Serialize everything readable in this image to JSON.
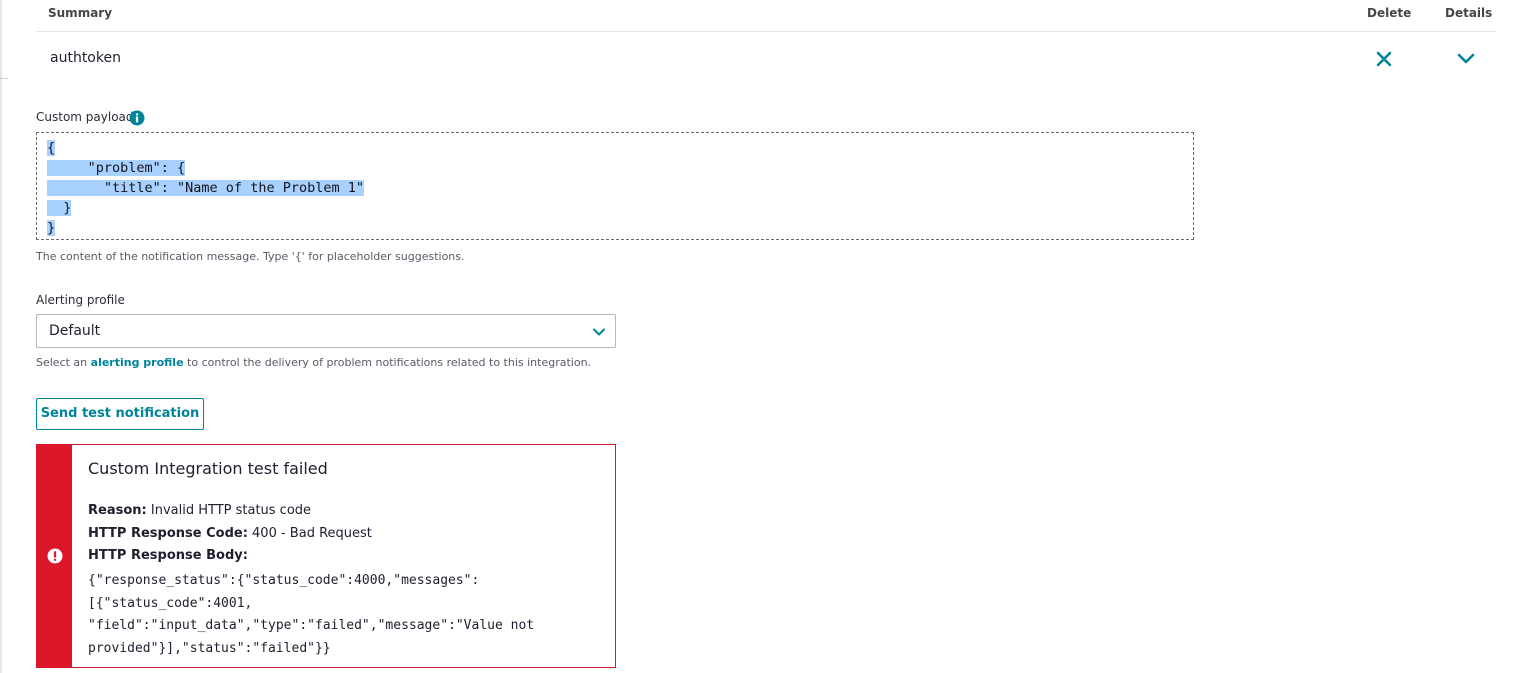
{
  "table": {
    "headers": {
      "summary": "Summary",
      "delete": "Delete",
      "details": "Details"
    },
    "row": {
      "name": "authtoken"
    }
  },
  "payload": {
    "label": "Custom payload",
    "lines": [
      "{",
      "     \"problem\": {",
      "       \"title\": \"Name of the Problem 1\"",
      "  }",
      "}"
    ],
    "help": "The content of the notification message. Type '{' for placeholder suggestions."
  },
  "alerting": {
    "label": "Alerting profile",
    "selected": "Default",
    "help_before": "Select an ",
    "help_link": "alerting profile",
    "help_after": " to control the delivery of problem notifications related to this integration."
  },
  "send_button": {
    "label": "Send test notification"
  },
  "error": {
    "title": "Custom Integration test failed",
    "reason_label": "Reason:",
    "reason_value": " Invalid HTTP status code",
    "code_label": "HTTP Response Code:",
    "code_value": " 400 - Bad Request",
    "body_label": "HTTP Response Body:",
    "body_lines": [
      "{\"response_status\":{\"status_code\":4000,\"messages\":",
      "[{\"status_code\":4001,",
      "\"field\":\"input_data\",\"type\":\"failed\",\"message\":\"Value not",
      "provided\"}],\"status\":\"failed\"}}"
    ]
  },
  "colors": {
    "accent": "#00849b",
    "error": "#dc172a",
    "selection": "#a8d1ff"
  },
  "icons": {
    "delete": "close-icon",
    "details": "chevron-down-icon",
    "info": "info-icon",
    "select": "chevron-down-icon",
    "error": "alert-circle-icon"
  }
}
